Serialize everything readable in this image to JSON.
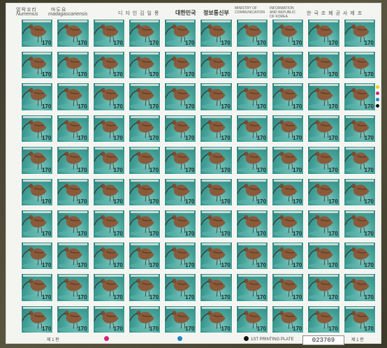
{
  "header": {
    "name_ko": "알락꼬리",
    "name_ko2": "마도요",
    "genus": "Numenius",
    "species": "madagascariensis",
    "designer": "디 자 인 김 일 룡",
    "country": "대한민국",
    "issuer": "정보통신부",
    "ministry_en": "MINISTRY OF COMMUNICATION",
    "info_en": "INFORMATION AND REPUBLIC OF KOREA",
    "printer": "한 국 조 폐 공 사 제 조"
  },
  "stamp": {
    "value": "170",
    "rows": 10,
    "cols": 10
  },
  "footer": {
    "plate_left": "제 1 판",
    "plate_right": "제 1 판",
    "printing_plate": "1ST PRINTING PLATE",
    "serial": "023769"
  },
  "colors": {
    "magenta": "#d6237a",
    "cyan": "#1e86c8",
    "yellow": "#e9d21c",
    "black": "#111111"
  }
}
